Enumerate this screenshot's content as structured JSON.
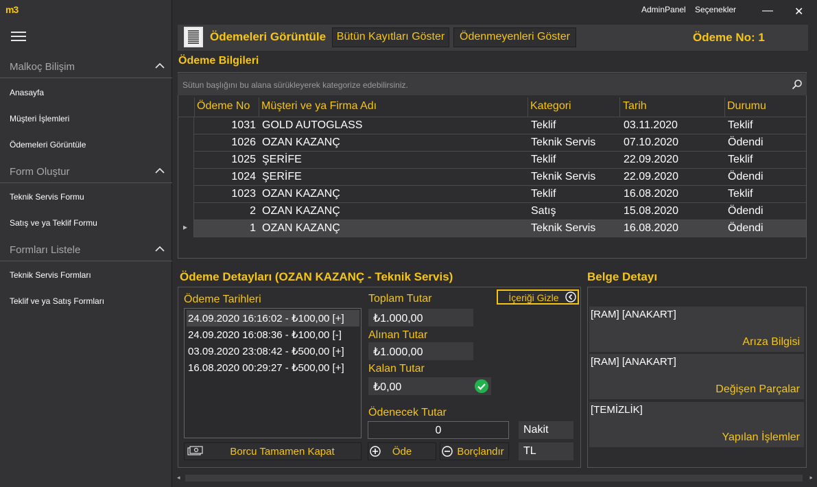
{
  "app": {
    "logo": "m3",
    "topbar": {
      "admin_label": "AdminPanel",
      "options_label": "Seçenekler",
      "minimize": "—",
      "close": "✕"
    }
  },
  "sidebar": {
    "groups": [
      {
        "title": "Malkoç Bilişim",
        "items": [
          "Anasayfa",
          "Müşteri İşlemleri",
          "Ödemeleri Görüntüle"
        ]
      },
      {
        "title": "Form Oluştur",
        "items": [
          "Teknik Servis Formu",
          "Satış ve ya Teklif Formu"
        ]
      },
      {
        "title": "Formları Listele",
        "items": [
          "Teknik Servis Formları",
          "Teklif ve ya Satış Formları"
        ]
      }
    ]
  },
  "toolbar": {
    "page_title": "Ödemeleri Görüntüle",
    "show_all_label": "Bütün Kayıtları Göster",
    "show_unpaid_label": "Ödenmeyenleri  Göster",
    "payment_no_label": "Ödeme No: 1"
  },
  "payment_info": {
    "title": "Ödeme Bilgileri",
    "search_placeholder": "Sütun başlığını bu alana sürükleyerek kategorize edebilirsiniz.",
    "columns": [
      "Ödeme No",
      "Müşteri ve ya Firma Adı",
      "Kategori",
      "Tarih",
      "Durumu"
    ],
    "rows": [
      {
        "no": "1031",
        "customer": "GOLD AUTOGLASS",
        "category": "Teklif",
        "date": "03.11.2020",
        "status": "Teklif"
      },
      {
        "no": "1026",
        "customer": "OZAN KAZANÇ",
        "category": "Teknik Servis",
        "date": "07.10.2020",
        "status": "Ödendi"
      },
      {
        "no": "1025",
        "customer": "ŞERİFE",
        "category": "Teklif",
        "date": "22.09.2020",
        "status": "Teklif"
      },
      {
        "no": "1024",
        "customer": "ŞERİFE",
        "category": "Teknik Servis",
        "date": "22.09.2020",
        "status": "Ödendi"
      },
      {
        "no": "1023",
        "customer": "OZAN KAZANÇ",
        "category": "Teklif",
        "date": "16.08.2020",
        "status": "Teklif"
      },
      {
        "no": "2",
        "customer": "OZAN KAZANÇ",
        "category": "Satış",
        "date": "15.08.2020",
        "status": "Ödendi"
      },
      {
        "no": "1",
        "customer": "OZAN KAZANÇ",
        "category": "Teknik Servis",
        "date": "16.08.2020",
        "status": "Ödendi"
      }
    ],
    "selected_row_marker": "▸"
  },
  "payment_details": {
    "title": "Ödeme Detayları (OZAN KAZANÇ - Teknik Servis)",
    "dates_label": "Ödeme Tarihleri",
    "dates": [
      "24.09.2020 16:16:02 - ₺100,00 [+]",
      "24.09.2020 16:08:36 - ₺100,00 [-]",
      "03.09.2020 23:08:42 - ₺500,00 [+]",
      "16.08.2020 00:29:27 - ₺500,00 [+]"
    ],
    "close_debt_label": "Borcu Tamamen Kapat",
    "total_label": "Toplam Tutar",
    "total_value": "₺1.000,00",
    "received_label": "Alınan Tutar",
    "received_value": "₺1.000,00",
    "remaining_label": "Kalan Tutar",
    "remaining_value": "₺0,00",
    "hide_content_label": "İçeriği Gizle",
    "to_pay_label": "Ödenecek Tutar",
    "to_pay_value": "0",
    "payment_type": "Nakit",
    "currency": "TL",
    "pay_label": "Öde",
    "debit_label": "Borçlandır"
  },
  "document_details": {
    "title": "Belge Detayı",
    "sections": [
      {
        "content": "[RAM] [ANAKART]",
        "label": "Arıza Bilgisi"
      },
      {
        "content": "[RAM] [ANAKART]",
        "label": "Değişen Parçalar"
      },
      {
        "content": "[TEMİZLİK]",
        "label": "Yapılan İşlemler"
      }
    ]
  }
}
